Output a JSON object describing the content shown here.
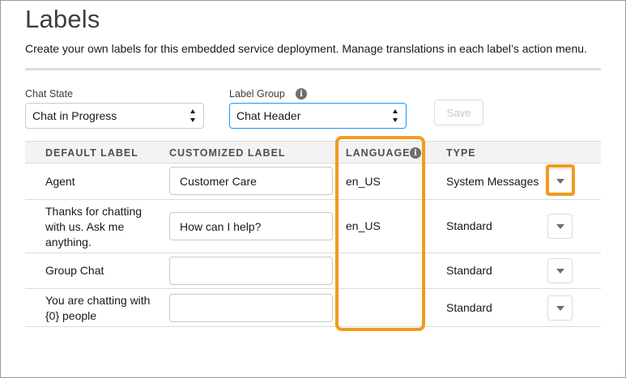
{
  "page": {
    "title": "Labels",
    "description": "Create your own labels for this embedded service deployment. Manage translations in each label’s action menu."
  },
  "filters": {
    "chat_state": {
      "label": "Chat State",
      "value": "Chat in Progress"
    },
    "label_group": {
      "label": "Label Group",
      "value": "Chat Header",
      "info_icon": "info-icon"
    },
    "save_label": "Save"
  },
  "table": {
    "headers": [
      "DEFAULT LABEL",
      "CUSTOMIZED LABEL",
      "LANGUAGE",
      "TYPE"
    ],
    "rows": [
      {
        "default_label": "Agent",
        "customized_label": "Customer Care",
        "language": "en_US",
        "type": "System Messages"
      },
      {
        "default_label": "Thanks for chatting with us. Ask me anything.",
        "customized_label": "How can I help?",
        "language": "en_US",
        "type": "Standard"
      },
      {
        "default_label": "Group Chat",
        "customized_label": "",
        "language": "",
        "type": "Standard"
      },
      {
        "default_label": "You are chatting with {0} people",
        "customized_label": "",
        "language": "",
        "type": "Standard"
      }
    ]
  },
  "colors": {
    "highlight": "#f39a1e",
    "focus_border": "#1b96ff",
    "header_bg": "#f3f3f3"
  }
}
